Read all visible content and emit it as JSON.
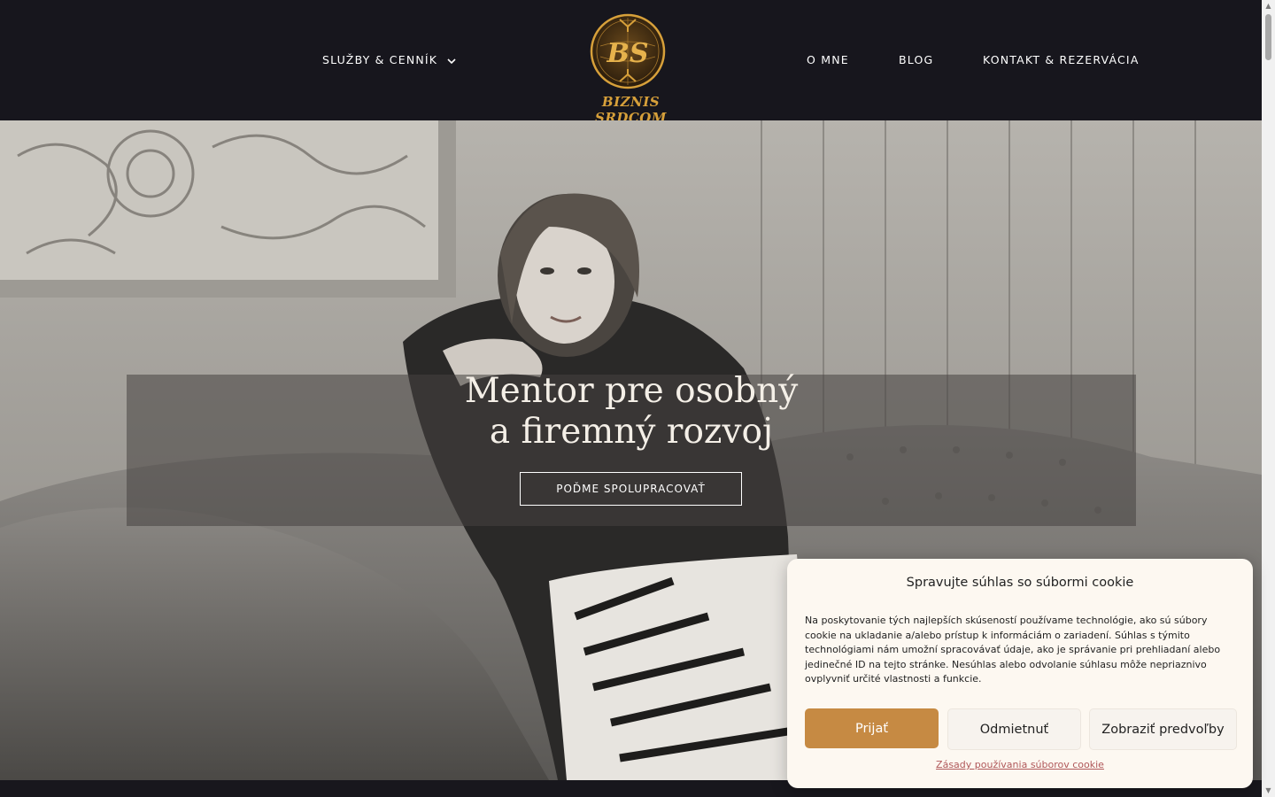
{
  "header": {
    "nav_left": {
      "services_label": "SLUŽBY & CENNÍK"
    },
    "nav_right": {
      "about_label": "O MNE",
      "blog_label": "BLOG",
      "contact_label": "KONTAKT & REZERVÁCIA"
    },
    "logo": {
      "monogram": "BS",
      "text": "BIZNIS SRDCOM"
    }
  },
  "hero": {
    "title_line1": "Mentor pre osobný",
    "title_line2": "a firemný rozvoj",
    "cta_label": "POĎME SPOLUPRACOVAŤ"
  },
  "cookie": {
    "title": "Spravujte súhlas so súbormi cookie",
    "text": "Na poskytovanie tých najlepších skúseností používame technológie, ako sú súbory cookie na ukladanie a/alebo prístup k informáciám o zariadení. Súhlas s týmito technológiami nám umožní spracovávať údaje, ako je správanie pri prehliadaní alebo jedinečné ID na tejto stránke. Nesúhlas alebo odvolanie súhlasu môže nepriaznivo ovplyvniť určité vlastnosti a funkcie.",
    "accept_label": "Prijať",
    "deny_label": "Odmietnuť",
    "prefs_label": "Zobraziť predvoľby",
    "policy_link": "Zásady používania súborov cookie"
  },
  "colors": {
    "header_bg": "#17161d",
    "gold": "#d7a03a",
    "accept_bg": "#c68a43",
    "link": "#b0585a"
  }
}
